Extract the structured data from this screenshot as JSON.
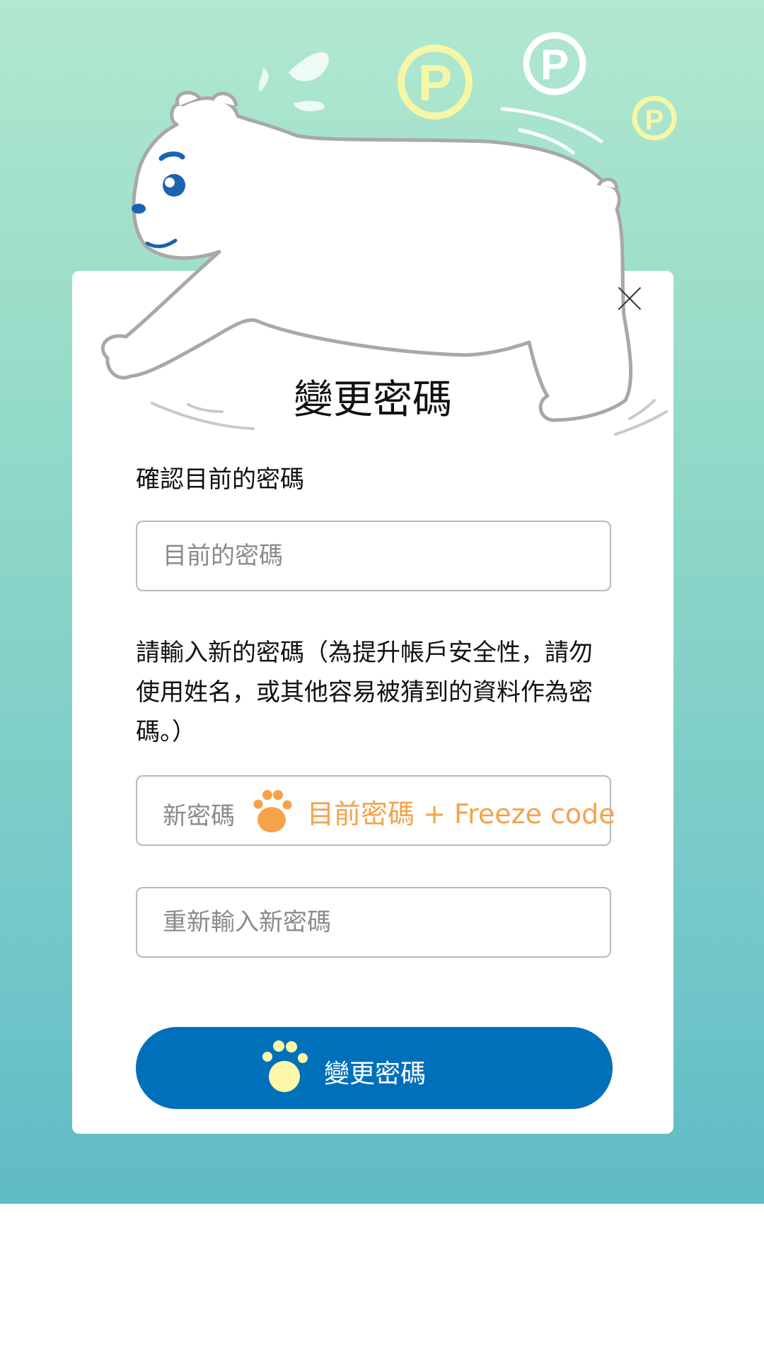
{
  "dialog": {
    "title": "變更密碼",
    "current_label": "確認目前的密碼",
    "current_placeholder": "目前的密碼",
    "new_label": "請輸入新的密碼（為提升帳戶安全性，請勿使用姓名，或其他容易被猜到的資料作為密碼。）",
    "new_placeholder": "新密碼",
    "new_hint": "目前密碼 + Freeze code",
    "confirm_placeholder": "重新輸入新密碼",
    "submit_label": "變更密碼"
  },
  "icons": {
    "close": "close-icon",
    "hint_paw": "paw-icon",
    "button_paw": "paw-icon",
    "mascot": "polar-bear-illustration",
    "coins": "p-coin-icon"
  },
  "colors": {
    "primary": "#0070bb",
    "hint": "#f5a24a",
    "button_paw": "#fff7a8",
    "coin": "#f6f7a6",
    "bear_eye": "#1a63b0"
  }
}
